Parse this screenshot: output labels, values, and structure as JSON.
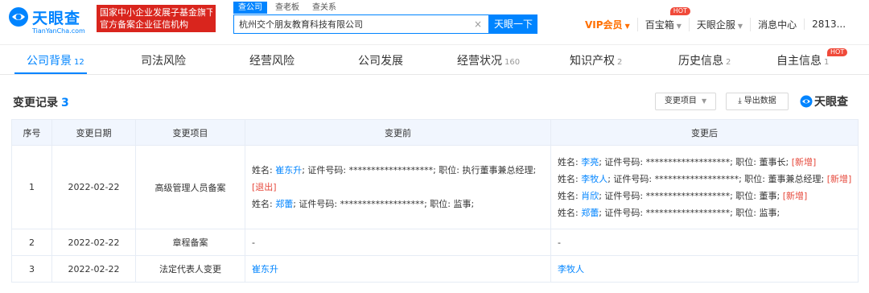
{
  "header": {
    "logo_cn": "天眼查",
    "logo_en": "TianYanCha.com",
    "banner_line1": "国家中小企业发展子基金旗下",
    "banner_line2": "官方备案企业征信机构",
    "search_tabs": [
      "查公司",
      "查老板",
      "查关系"
    ],
    "search_value": "杭州交个朋友教育科技有限公司",
    "search_button": "天眼一下",
    "nav": {
      "vip": "VIP会员",
      "treasure": "百宝箱",
      "treasure_badge": "HOT",
      "enterprise": "天眼企服",
      "messages": "消息中心",
      "user": "2813..."
    },
    "colors": {
      "brand_blue": "#0084ff",
      "banner_red": "#d9251d",
      "vip_orange": "#ff6f00",
      "tag_red": "#e6493c",
      "table_header_bg": "#f1f6fe"
    }
  },
  "tabs": [
    {
      "label": "公司背景",
      "count": "12"
    },
    {
      "label": "司法风险",
      "count": ""
    },
    {
      "label": "经营风险",
      "count": ""
    },
    {
      "label": "公司发展",
      "count": ""
    },
    {
      "label": "经营状况",
      "count": "160"
    },
    {
      "label": "知识产权",
      "count": "2"
    },
    {
      "label": "历史信息",
      "count": "2"
    },
    {
      "label": "自主信息",
      "count": "1"
    }
  ],
  "tab_hot_badge": "HOT",
  "section": {
    "title": "变更记录",
    "count": "3",
    "filter_button": "变更项目",
    "export_button": "导出数据",
    "brand": "天眼查"
  },
  "table": {
    "headers": [
      "序号",
      "变更日期",
      "变更项目",
      "变更前",
      "变更后"
    ],
    "rows": [
      {
        "index": "1",
        "date": "2022-02-22",
        "item": "高级管理人员备案",
        "before": [
          {
            "prefix": "姓名: ",
            "name": "崔东升",
            "rest": "; 证件号码: *******************; 职位: 执行董事兼总经理;",
            "tag": ""
          },
          {
            "prefix": "",
            "name": "",
            "rest": "",
            "tag": "[退出]"
          },
          {
            "prefix": "姓名: ",
            "name": "郑蕾",
            "rest": "; 证件号码: *******************; 职位: 监事;",
            "tag": ""
          }
        ],
        "after": [
          {
            "prefix": "姓名: ",
            "name": "李亮",
            "rest": "; 证件号码: *******************; 职位: 董事长;",
            "tag": "[新增]"
          },
          {
            "prefix": "姓名: ",
            "name": "李牧人",
            "rest": "; 证件号码: *******************; 职位: 董事兼总经理;",
            "tag": "[新增]"
          },
          {
            "prefix": "姓名: ",
            "name": "肖欣",
            "rest": "; 证件号码: *******************; 职位: 董事;",
            "tag": "[新增]"
          },
          {
            "prefix": "姓名: ",
            "name": "郑蕾",
            "rest": "; 证件号码: *******************; 职位: 监事;",
            "tag": ""
          }
        ]
      },
      {
        "index": "2",
        "date": "2022-02-22",
        "item": "章程备案",
        "before_text": "-",
        "after_text": "-"
      },
      {
        "index": "3",
        "date": "2022-02-22",
        "item": "法定代表人变更",
        "before_text": "崔东升",
        "after_text": "李牧人"
      }
    ]
  }
}
